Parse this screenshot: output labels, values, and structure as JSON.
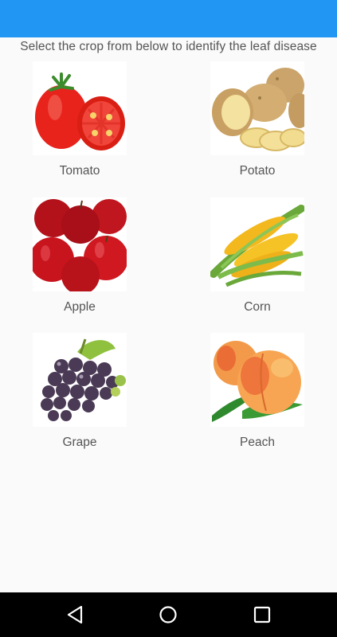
{
  "theme": {
    "app_bar_color": "#2196f3",
    "nav_bar_color": "#000000",
    "text_color": "#555555"
  },
  "instruction": "Select the crop from below to identify the leaf disease",
  "crops": [
    {
      "label": "Tomato",
      "icon": "tomato-icon"
    },
    {
      "label": "Potato",
      "icon": "potato-icon"
    },
    {
      "label": "Apple",
      "icon": "apple-icon"
    },
    {
      "label": "Corn",
      "icon": "corn-icon"
    },
    {
      "label": "Grape",
      "icon": "grape-icon"
    },
    {
      "label": "Peach",
      "icon": "peach-icon"
    }
  ],
  "nav": {
    "back": "back-icon",
    "home": "home-icon",
    "recents": "recents-icon"
  }
}
